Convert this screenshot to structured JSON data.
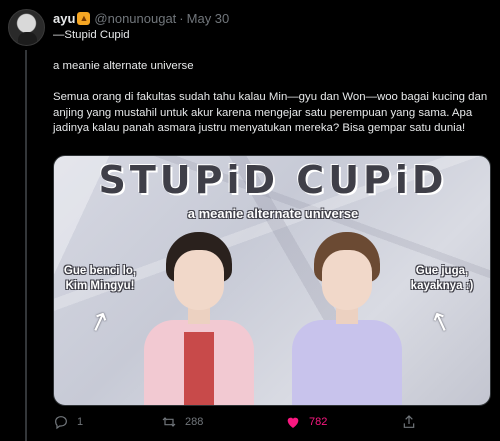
{
  "tweet": {
    "author_name": "ayu",
    "author_emoji": "🦁",
    "handle": "@nonunougat",
    "separator": "·",
    "date": "May 30",
    "lines": {
      "title": "—Stupid Cupid",
      "subtitle": "a meanie alternate universe",
      "body": "Semua orang di fakultas sudah tahu kalau Min—gyu dan Won—woo bagai kucing dan anjing yang mustahil untuk akur karena mengejar satu perempuan yang sama. Apa jadinya kalau panah asmara justru menyatukan mereka? Bisa gempar satu dunia!"
    },
    "image": {
      "title": "STUPiD CUPiD",
      "subtitle": "a meanie alternate universe",
      "bubble_left": "Gue benci lo, Kim Mingyu!",
      "bubble_right": "Gue juga, kayaknya :)"
    },
    "actions": {
      "reply_count": "1",
      "retweet_count": "288",
      "like_count": "782"
    },
    "colors": {
      "background": "#000000",
      "text": "#e7e9ea",
      "muted": "#71767b",
      "like": "#f91880"
    },
    "icons": [
      "reply-icon",
      "retweet-icon",
      "heart-icon",
      "share-icon"
    ]
  }
}
